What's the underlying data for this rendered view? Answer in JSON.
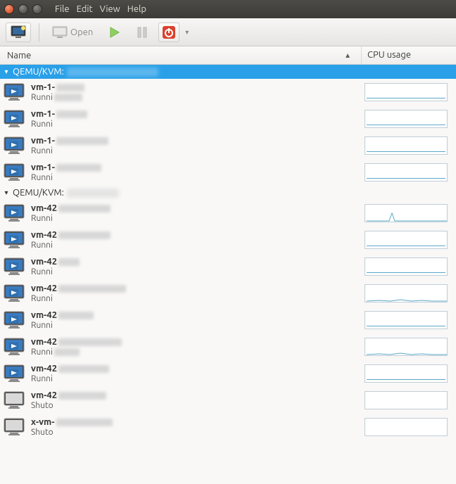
{
  "menubar": {
    "file": "File",
    "edit": "Edit",
    "view": "View",
    "help": "Help"
  },
  "toolbar": {
    "new_tooltip": "New VM",
    "open_label": "Open",
    "run_tooltip": "Run",
    "pause_tooltip": "Pause",
    "shutdown_tooltip": "Shut Down"
  },
  "columns": {
    "name": "Name",
    "cpu": "CPU usage",
    "sort_dir": "asc"
  },
  "groups": [
    {
      "label": "QEMU/KVM:",
      "expanded": true,
      "selected": true,
      "host_blur_w": 130,
      "vms": [
        {
          "name": "vm-1-",
          "state": "Runni",
          "running": true,
          "name_blur_w": 40,
          "state_blur_w": 40,
          "cpu": {
            "type": "flat"
          }
        },
        {
          "name": "vm-1-",
          "state": "Runni",
          "running": true,
          "name_blur_w": 44,
          "state_blur_w": 0,
          "cpu": {
            "type": "flat"
          }
        },
        {
          "name": "vm-1-",
          "state": "Runni",
          "running": true,
          "name_blur_w": 74,
          "state_blur_w": 0,
          "cpu": {
            "type": "flat"
          }
        },
        {
          "name": "vm-1-",
          "state": "Runni",
          "running": true,
          "name_blur_w": 64,
          "state_blur_w": 0,
          "cpu": {
            "type": "flat"
          }
        }
      ]
    },
    {
      "label": "QEMU/KVM:",
      "expanded": true,
      "selected": false,
      "host_blur_w": 74,
      "vms": [
        {
          "name": "vm-42",
          "state": "Runni",
          "running": true,
          "name_blur_w": 74,
          "state_blur_w": 0,
          "cpu": {
            "type": "spike",
            "pos": 0.32,
            "h": 11
          }
        },
        {
          "name": "vm-42",
          "state": "Runni",
          "running": true,
          "name_blur_w": 74,
          "state_blur_w": 0,
          "cpu": {
            "type": "flat"
          }
        },
        {
          "name": "vm-42",
          "state": "Runni",
          "running": true,
          "name_blur_w": 30,
          "state_blur_w": 0,
          "cpu": {
            "type": "flat"
          }
        },
        {
          "name": "vm-42",
          "state": "Runni",
          "running": true,
          "name_blur_w": 96,
          "state_blur_w": 0,
          "cpu": {
            "type": "wave"
          }
        },
        {
          "name": "vm-42",
          "state": "Runni",
          "running": true,
          "name_blur_w": 50,
          "state_blur_w": 0,
          "cpu": {
            "type": "flat"
          }
        },
        {
          "name": "vm-42",
          "state": "Runni",
          "running": true,
          "name_blur_w": 90,
          "state_blur_w": 36,
          "cpu": {
            "type": "wave"
          }
        },
        {
          "name": "vm-42",
          "state": "Runni",
          "running": true,
          "name_blur_w": 72,
          "state_blur_w": 0,
          "cpu": {
            "type": "flat"
          }
        },
        {
          "name": "vm-42",
          "state": "Shuto",
          "running": false,
          "name_blur_w": 68,
          "state_blur_w": 0,
          "cpu": {
            "type": "none"
          }
        },
        {
          "name": "x-vm-",
          "state": "Shuto",
          "running": false,
          "name_blur_w": 80,
          "state_blur_w": 0,
          "cpu": {
            "type": "none"
          }
        }
      ]
    }
  ]
}
